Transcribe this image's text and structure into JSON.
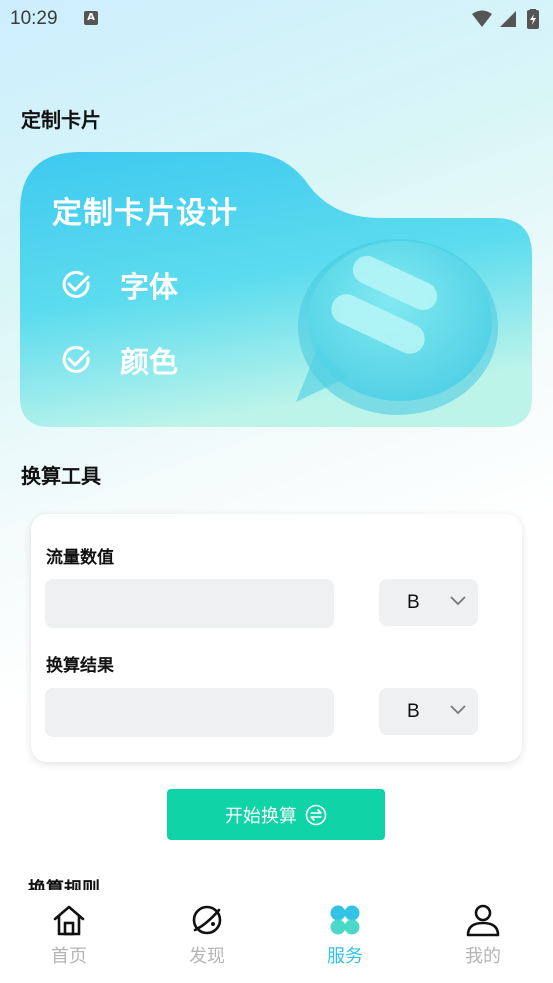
{
  "status": {
    "time": "10:29",
    "notification_icon": "A"
  },
  "sections": {
    "custom_card": "定制卡片",
    "converter": "换算工具",
    "rules": "换算规则"
  },
  "promo": {
    "title": "定制卡片设计",
    "features": [
      "字体",
      "颜色"
    ]
  },
  "converter": {
    "input_label": "流量数值",
    "input_value": "",
    "input_unit": "B",
    "result_label": "换算结果",
    "result_value": "",
    "result_unit": "B",
    "start_button": "开始换算"
  },
  "tabs": [
    {
      "label": "首页",
      "icon": "home-icon",
      "active": false
    },
    {
      "label": "发现",
      "icon": "planet-icon",
      "active": false
    },
    {
      "label": "服务",
      "icon": "clover-icon",
      "active": true
    },
    {
      "label": "我的",
      "icon": "user-icon",
      "active": false
    }
  ],
  "colors": {
    "accent": "#10d3a7",
    "active_tab": "#33c3e6",
    "inactive_tab": "#b5b5b5"
  }
}
